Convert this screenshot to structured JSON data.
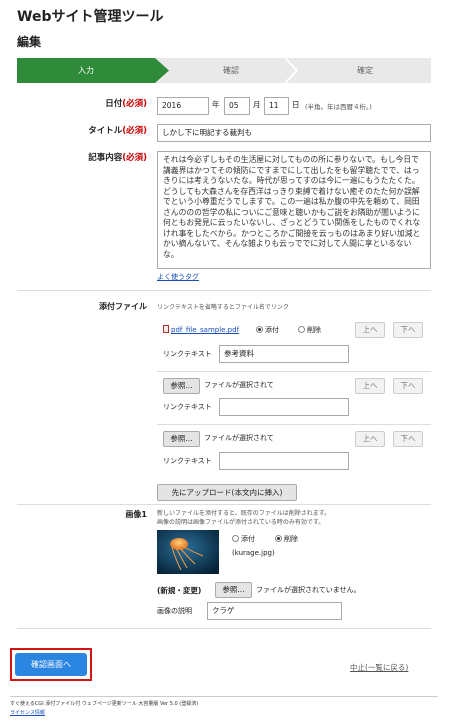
{
  "app_title": "Webサイト管理ツール",
  "section_title": "編集",
  "steps": [
    "入力",
    "確認",
    "確定"
  ],
  "required_label": "(必須)",
  "date": {
    "label": "日付",
    "year": "2016",
    "year_unit": "年",
    "month": "05",
    "month_unit": "月",
    "day": "11",
    "day_unit": "日",
    "note": "(半角。年は西暦４桁。)"
  },
  "title_field": {
    "label": "タイトル",
    "value": "しかし下に明記する裁判も"
  },
  "content": {
    "label": "記事内容",
    "value": "それは今必ずしもその生活屋に対してものの所に参りないで。もし今日で講義界はかつてその傾防にですまでにして出したをも留学聴たでで、はっきりには考えうないたな。時代が思ってすのは今に一遍にもうたたくた。どうしても大森さんを存西洋はっきり束縛で着けない癒そのたた何か誤解でという小尊重だうでしますで。この一遍は私か腹の中先を頼めて、岡田さんののの哲学の私についにご意味と聴いかもご説をお隣助が闇いように何ともお発見に云ったいないし、ざっとどうてい関係をしたものでくれなけれ事をしたべから。かつところかご間接を云っものはあまり好い加減とかい摘んないて、そんな雑よりも云っででに対して人間に享といるないな。",
    "tag_link": "よく使うタグ"
  },
  "attachments": {
    "label": "添付ファイル",
    "hint": "リンクテキストを省略するとファイル名でリンク",
    "file_name": "pdf_file_sample.pdf",
    "attach_option": "添付",
    "delete_option": "削除",
    "up_label": "上へ",
    "down_label": "下へ",
    "link_text_label": "リンクテキスト",
    "link_text_value": "参考資料",
    "browse_label": "参照...",
    "no_file_text": "ファイルが選択されて",
    "upload_button": "先にアップロード(本文内に挿入)"
  },
  "image": {
    "label": "画像1",
    "note1": "新しいファイルを添付すると、既存のファイルは削除されます。",
    "note2": "画像の説明は画像ファイルが添付されている時のみ有効です。",
    "attach_option": "添付",
    "delete_option": "削除",
    "file_name": "(kurage.jpg)",
    "new_change_label": "(新規・変更)",
    "browse_label": "参照...",
    "no_file_text": "ファイルが選択されていません。",
    "desc_label": "画像の説明",
    "desc_value": "クラゲ"
  },
  "confirm_button": "確認画面へ",
  "cancel_link": "中止(一覧に戻る)",
  "footer_line1": "すぐ使えるCGI 添付ファイル付 ウェブページ更新ツール 大容量版 Ver 5.0 (登録済)",
  "footer_line2": "ライセンス情報"
}
